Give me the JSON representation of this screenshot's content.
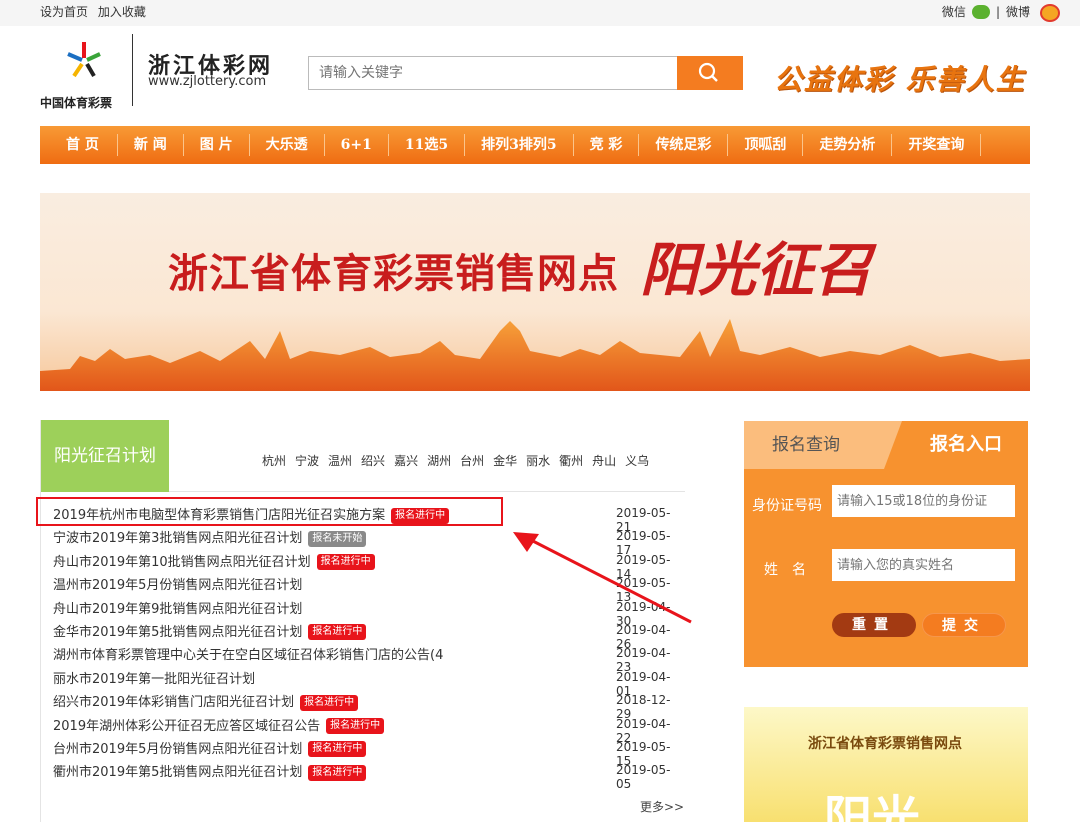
{
  "topbar": {
    "set_home": "设为首页",
    "bookmark": "加入收藏",
    "wechat": "微信",
    "sep": "|",
    "weibo": "微博"
  },
  "header": {
    "logo_text": "中国体育彩票",
    "site_name": "浙江体彩网",
    "site_url": "www.zjlottery.com",
    "search_placeholder": "请输入关键字",
    "slogan": "公益体彩 乐善人生"
  },
  "nav": {
    "items": [
      "首 页",
      "新 闻",
      "图 片",
      "大乐透",
      "6+1",
      "11选5",
      "排列3排列5",
      "竞 彩",
      "传统足彩",
      "顶呱刮",
      "走势分析",
      "开奖查询"
    ]
  },
  "banner": {
    "line1": "浙江省体育彩票销售网点",
    "line2": "阳光征召"
  },
  "recruit": {
    "tab_label": "阳光征召计划",
    "cities": [
      "杭州",
      "宁波",
      "温州",
      "绍兴",
      "嘉兴",
      "湖州",
      "台州",
      "金华",
      "丽水",
      "衢州",
      "舟山",
      "义乌"
    ],
    "rows": [
      {
        "title": "2019年杭州市电脑型体育彩票销售门店阳光征召实施方案",
        "badge": "报名进行中",
        "badge_type": "on",
        "date": "2019-05-21"
      },
      {
        "title": "宁波市2019年第3批销售网点阳光征召计划",
        "badge": "报名未开始",
        "badge_type": "wait",
        "date": "2019-05-17"
      },
      {
        "title": "舟山市2019年第10批销售网点阳光征召计划",
        "badge": "报名进行中",
        "badge_type": "on",
        "date": "2019-05-14"
      },
      {
        "title": "温州市2019年5月份销售网点阳光征召计划",
        "badge": "",
        "badge_type": "",
        "date": "2019-05-13"
      },
      {
        "title": "舟山市2019年第9批销售网点阳光征召计划",
        "badge": "",
        "badge_type": "",
        "date": "2019-04-30"
      },
      {
        "title": "金华市2019年第5批销售网点阳光征召计划",
        "badge": "报名进行中",
        "badge_type": "on",
        "date": "2019-04-26"
      },
      {
        "title": "湖州市体育彩票管理中心关于在空白区域征召体彩销售门店的公告(4",
        "badge": "",
        "badge_type": "",
        "date": "2019-04-23"
      },
      {
        "title": "丽水市2019年第一批阳光征召计划",
        "badge": "",
        "badge_type": "",
        "date": "2019-04-01"
      },
      {
        "title": "绍兴市2019年体彩销售门店阳光征召计划",
        "badge": "报名进行中",
        "badge_type": "on",
        "date": "2018-12-29"
      },
      {
        "title": "2019年湖州体彩公开征召无应答区域征召公告",
        "badge": "报名进行中",
        "badge_type": "on",
        "date": "2019-04-22"
      },
      {
        "title": "台州市2019年5月份销售网点阳光征召计划",
        "badge": "报名进行中",
        "badge_type": "on",
        "date": "2019-05-15"
      },
      {
        "title": "衢州市2019年第5批销售网点阳光征召计划",
        "badge": "报名进行中",
        "badge_type": "on",
        "date": "2019-05-05"
      }
    ],
    "more": "更多>>"
  },
  "register": {
    "tab_query": "报名查询",
    "tab_entry": "报名入口",
    "id_label": "身份证号码",
    "id_placeholder": "请输入15或18位的身份证",
    "name_label": "姓　名",
    "name_placeholder": "请输入您的真实姓名",
    "reset": "重置",
    "submit": "提交"
  },
  "side_banner": {
    "text": "浙江省体育彩票销售网点",
    "big": "阳光"
  },
  "colors": {
    "orange": "#f47c20",
    "green": "#9dd05a",
    "red": "#e8141b"
  }
}
